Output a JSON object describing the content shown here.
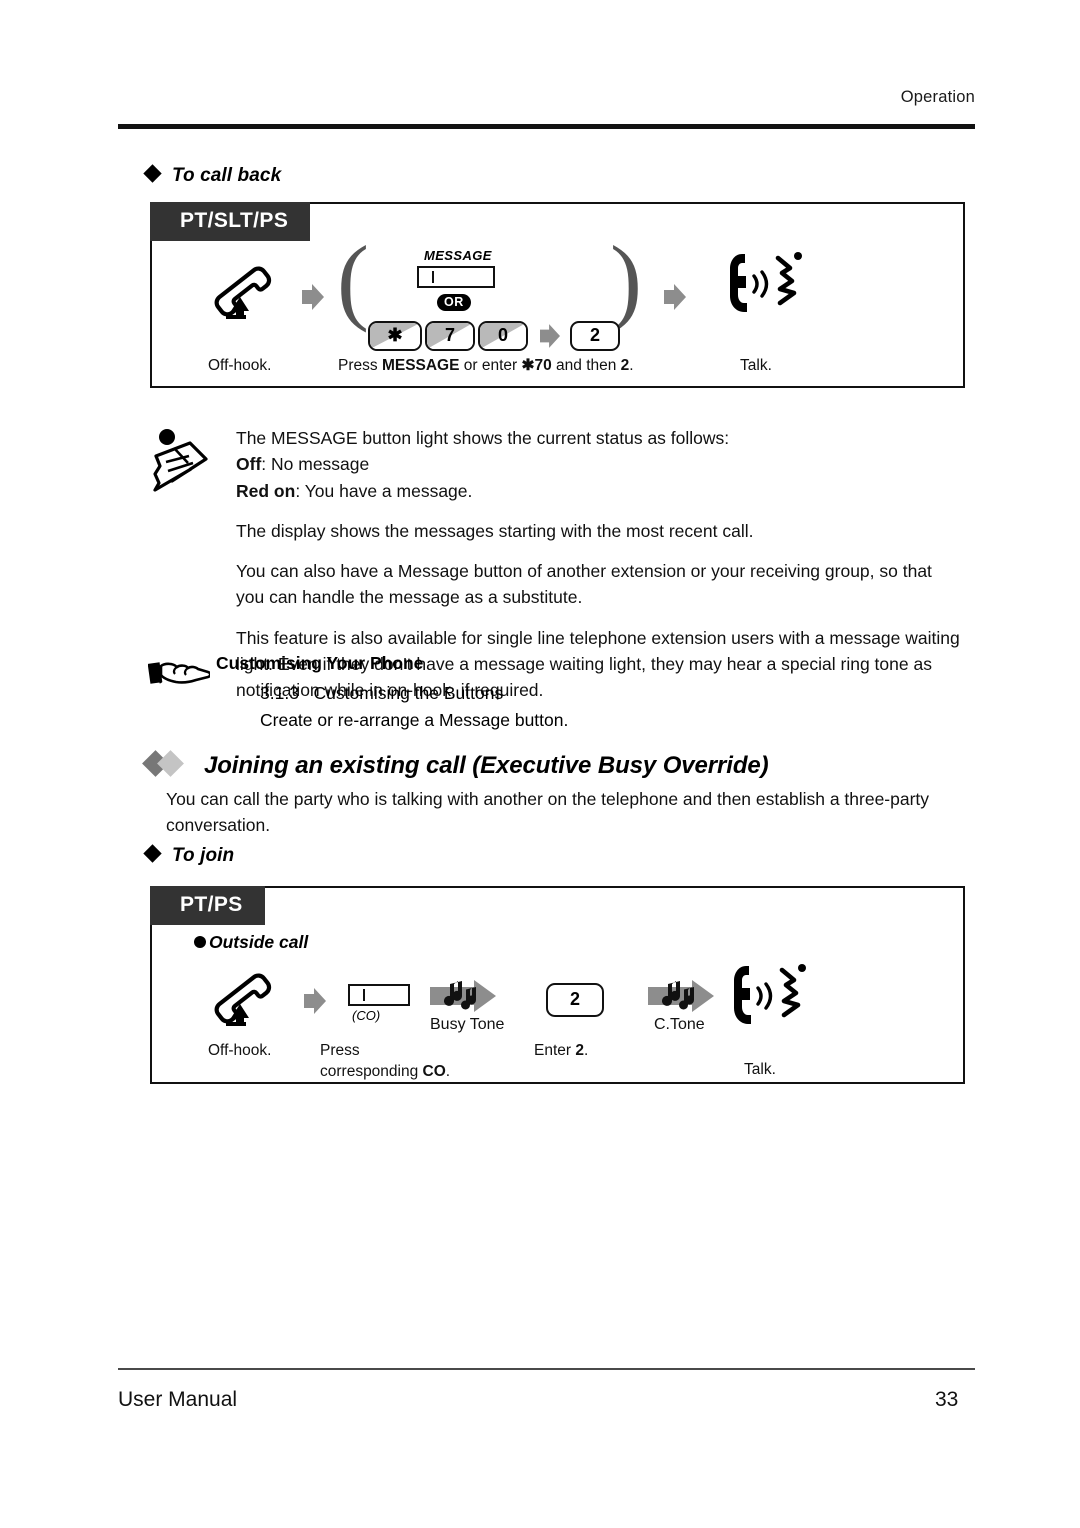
{
  "header": {
    "section_label": "Operation"
  },
  "call_back": {
    "heading": "To call back",
    "diagram": {
      "device_tab": "PT/SLT/PS",
      "steps": [
        {
          "icon": "offhook-handset-icon",
          "caption": "Off-hook."
        },
        {
          "icon": "message-button-icon",
          "caption": "Press MESSAGE or enter ✱70 and then 2."
        },
        {
          "icon": "talk-handset-icon",
          "caption": "Talk."
        }
      ],
      "button_label": "MESSAGE",
      "or_label": "OR",
      "keys": [
        "✱",
        "7",
        "0"
      ],
      "second_key": "2",
      "caption_press_plain1": "Press ",
      "caption_press_bold1": "MESSAGE",
      "caption_press_plain2": " or enter ",
      "caption_press_bold2": "✱70",
      "caption_press_plain3": " and then ",
      "caption_press_bold3": "2",
      "caption_press_plain4": "."
    }
  },
  "note": {
    "icon": "note-memo-icon",
    "line1": "The MESSAGE button light shows the current status as follows:",
    "line2_bold": "Off",
    "line2_rest": ": No message",
    "line3_bold": "Red on",
    "line3_rest": ": You have a message.",
    "para2": "The display shows the messages starting with the most recent call.",
    "para3": "You can also have a Message button of another extension or your receiving group, so that you can handle the message as a substitute.",
    "para4": "This feature is also available for single line telephone extension users with a message waiting light. Even if they don't have a message waiting light, they may hear a special ring tone as notification while in on-hook, if required."
  },
  "customising": {
    "icon": "pointing-hand-icon",
    "title": "Customising Your Phone",
    "ref_number": "3.1.3",
    "ref_title": "Customising the Buttons",
    "ref_desc": "Create or re-arrange a Message button."
  },
  "feature": {
    "heading": "Joining an existing call (Executive Busy Override)",
    "description": "You can call the party who is talking with another on the telephone and then establish a three-party conversation."
  },
  "to_join": {
    "heading": "To join",
    "diagram": {
      "device_tab": "PT/PS",
      "call_type": "Outside call",
      "co_button_label": "(CO)",
      "busy_tone_label": "Busy Tone",
      "c_tone_label": "C.Tone",
      "key": "2",
      "caption_offhook": "Off-hook.",
      "caption_press_line1": "Press",
      "caption_press_line2_plain": "corresponding ",
      "caption_press_line2_bold": "CO",
      "caption_press_line2_end": ".",
      "caption_enter_plain": "Enter ",
      "caption_enter_bold": "2",
      "caption_enter_end": ".",
      "caption_talk": "Talk."
    }
  },
  "footer": {
    "manual_name": "User Manual",
    "page_number": "33"
  }
}
